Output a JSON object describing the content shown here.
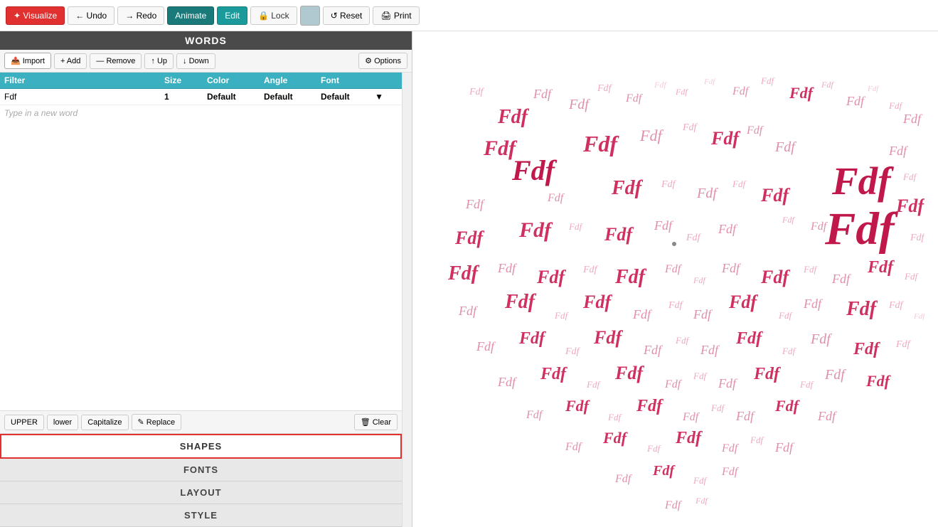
{
  "app": {
    "title": "WORDS"
  },
  "toolbar": {
    "visualize_label": "✦ Visualize",
    "undo_label": "← Undo",
    "redo_label": "→ Redo",
    "animate_label": "Animate",
    "edit_label": "Edit",
    "lock_label": "🔒 Lock",
    "reset_label": "↺ Reset",
    "print_label": "🖨 Print"
  },
  "words_panel": {
    "import_label": "📤 Import",
    "add_label": "+ Add",
    "remove_label": "— Remove",
    "up_label": "↑ Up",
    "down_label": "↓ Down",
    "options_label": "⚙ Options",
    "columns": {
      "filter": "Filter",
      "size": "Size",
      "color": "Color",
      "angle": "Angle",
      "font": "Font"
    },
    "rows": [
      {
        "word": "Fdf",
        "size": "1",
        "color": "Default",
        "angle": "Default",
        "font": "Default"
      }
    ],
    "new_word_placeholder": "Type in a new word"
  },
  "bottom_toolbar": {
    "upper_label": "UPPER",
    "lower_label": "lower",
    "capitalize_label": "Capitalize",
    "replace_label": "✎ Replace",
    "clear_label": "🗑 Clear"
  },
  "menu": {
    "items": [
      {
        "label": "SHAPES",
        "active": true
      },
      {
        "label": "FONTS",
        "active": false
      },
      {
        "label": "LAYOUT",
        "active": false
      },
      {
        "label": "STYLE",
        "active": false
      }
    ]
  },
  "colors": {
    "accent_red": "#e03030",
    "accent_teal_dark": "#1a7a7a",
    "accent_teal": "#1a9a9a",
    "header_blue": "#3ab0c0"
  }
}
